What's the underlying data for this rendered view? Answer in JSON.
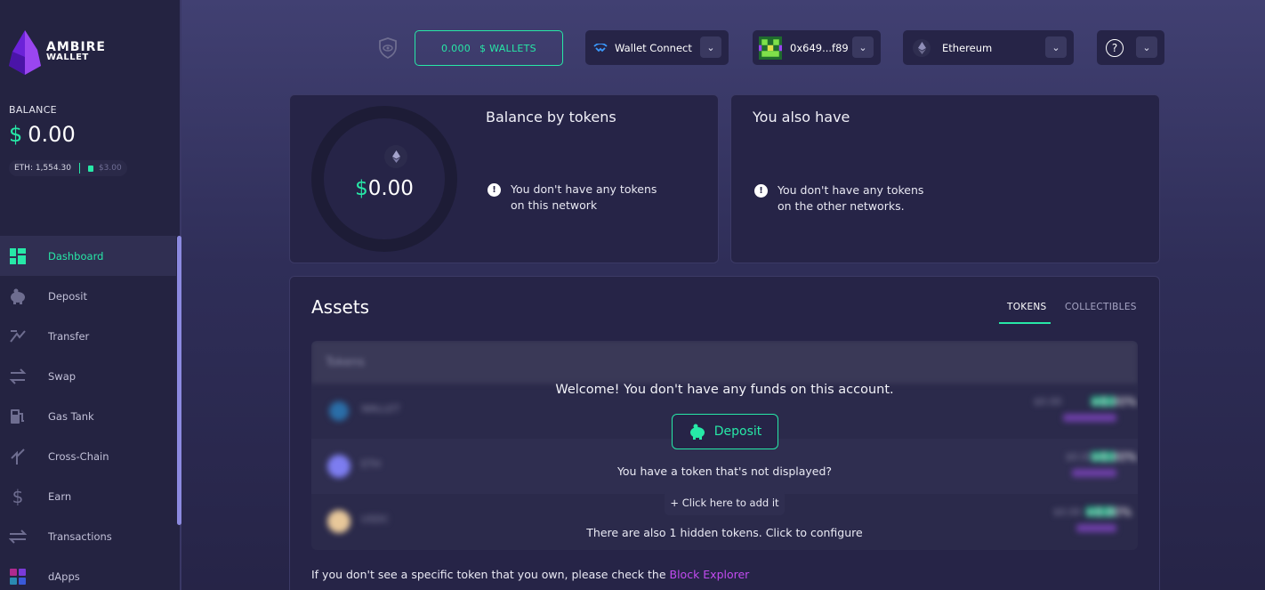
{
  "brand": {
    "line1": "AMBIRE",
    "line2": "WALLET"
  },
  "sidebar": {
    "balance_label": "BALANCE",
    "balance_currency": "$",
    "balance_amount": "0.00",
    "eth_price": "ETH: 1,554.30",
    "gas_amount": "$3.00",
    "items": [
      {
        "label": "Dashboard",
        "icon": "dashboard-icon",
        "active": true
      },
      {
        "label": "Deposit",
        "icon": "piggy-bank-icon"
      },
      {
        "label": "Transfer",
        "icon": "transfer-icon"
      },
      {
        "label": "Swap",
        "icon": "swap-icon"
      },
      {
        "label": "Gas Tank",
        "icon": "gas-pump-icon"
      },
      {
        "label": "Cross-Chain",
        "icon": "cross-chain-icon"
      },
      {
        "label": "Earn",
        "icon": "dollar-icon"
      },
      {
        "label": "Transactions",
        "icon": "transactions-icon"
      },
      {
        "label": "dApps",
        "icon": "dapps-icon"
      }
    ]
  },
  "header": {
    "wallets_amount": "0.000",
    "wallets_label": "$ WALLETS",
    "walletconnect_label": "Wallet Connect",
    "account_label": "0x649...f89",
    "network_label": "Ethereum",
    "help_icon": "question-circle-icon"
  },
  "balance_card": {
    "currency": "$",
    "amount": "0.00",
    "title": "Balance by tokens",
    "notice_line1": "You don't have any tokens",
    "notice_line2": "on this network"
  },
  "also_card": {
    "title": "You also have",
    "notice_line1": "You don't have any tokens",
    "notice_line2": "on the other networks."
  },
  "assets": {
    "title": "Assets",
    "tabs": [
      {
        "label": "TOKENS",
        "active": true
      },
      {
        "label": "COLLECTIBLES",
        "active": false
      }
    ],
    "blurred_header": "Tokens",
    "blurred_rows": [
      {
        "symbol": "WALLET",
        "value": "$0.00",
        "change": "+0.00%"
      },
      {
        "symbol": "ETH",
        "value": "$0.00",
        "change": "+0.00%"
      },
      {
        "symbol": "USDC",
        "value": "$0.00",
        "change": "+0.00%"
      }
    ],
    "welcome": "Welcome! You don't have any funds on this account.",
    "deposit_label": "Deposit",
    "not_displayed": "You have a token that's not displayed?",
    "add_label": "+  Click here to add it",
    "hidden_tokens": "There are also 1 hidden tokens. Click to configure",
    "footnote": "If you don't see a specific token that you own, please check the",
    "footnote_link": "Block Explorer"
  },
  "colors": {
    "accent": "#27e8a7",
    "link": "#c24bf0",
    "bg": "#262447"
  }
}
